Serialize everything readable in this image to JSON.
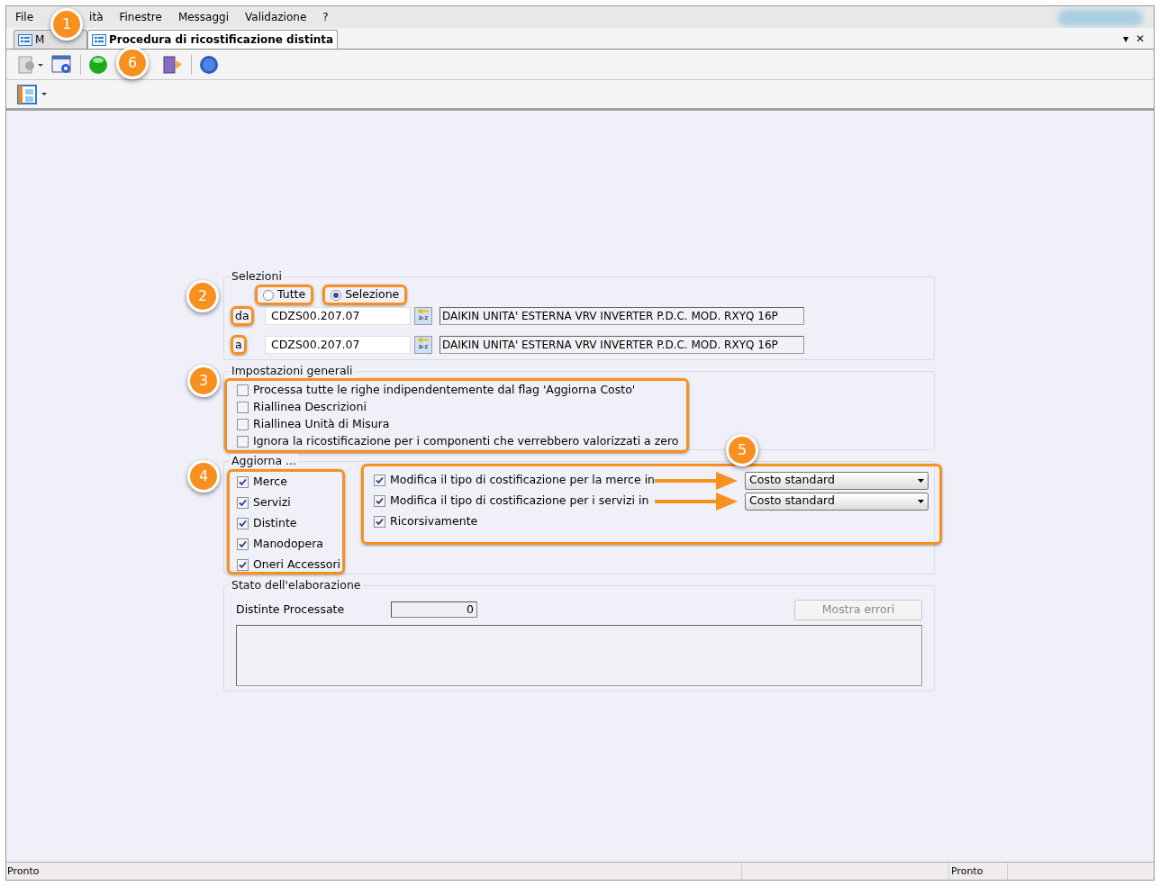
{
  "menu": [
    {
      "label": "File"
    },
    {
      "label": "ità"
    },
    {
      "label": "Finestre"
    },
    {
      "label": "Messaggi"
    },
    {
      "label": "Validazione"
    },
    {
      "label": "?"
    }
  ],
  "tabs": [
    {
      "label": "M",
      "selected": false
    },
    {
      "label": "Procedura di ricostificazione distinta",
      "selected": true
    }
  ],
  "tab_controls": {
    "dropdown": "▾",
    "close": "✕"
  },
  "selezioni": {
    "title": "Selezioni",
    "radios": [
      {
        "label": "Tutte",
        "selected": false
      },
      {
        "label": "Selezione",
        "selected": true
      }
    ],
    "ranges": [
      {
        "label": "da",
        "code": "CDZS00.207.07",
        "lookup": "a-z",
        "description": "DAIKIN UNITA' ESTERNA VRV INVERTER P.D.C. MOD. RXYQ 16P"
      },
      {
        "label": "a",
        "code": "CDZS00.207.07",
        "lookup": "a-z",
        "description": "DAIKIN UNITA' ESTERNA VRV INVERTER P.D.C. MOD. RXYQ 16P"
      }
    ]
  },
  "impostazioni": {
    "title": "Impostazioni generali",
    "options": [
      {
        "label": "Processa tutte le righe indipendentemente dal flag 'Aggiorna Costo'",
        "checked": false
      },
      {
        "label": "Riallinea Descrizioni",
        "checked": false
      },
      {
        "label": "Riallinea Unità di Misura",
        "checked": false
      },
      {
        "label": "Ignora la ricostificazione per i componenti che verrebbero valorizzati a zero",
        "checked": false
      }
    ]
  },
  "aggiorna": {
    "title": "Aggiorna ...",
    "items": [
      {
        "label": "Merce",
        "checked": true
      },
      {
        "label": "Servizi",
        "checked": true
      },
      {
        "label": "Distinte",
        "checked": true
      },
      {
        "label": "Manodopera",
        "checked": true
      },
      {
        "label": "Oneri Accessori",
        "checked": true
      }
    ],
    "modifiche": [
      {
        "label": "Modifica il tipo di costificazione per la merce in",
        "checked": true,
        "value": "Costo standard"
      },
      {
        "label": "Modifica il tipo di costificazione per i servizi in",
        "checked": true,
        "value": "Costo standard"
      },
      {
        "label": "Ricorsivamente",
        "checked": true
      }
    ]
  },
  "stato": {
    "title": "Stato dell'elaborazione",
    "counter_label": "Distinte Processate",
    "counter_value": "0",
    "button": {
      "label": "Mostra errori",
      "disabled": true
    }
  },
  "status_bar": [
    "Pronto",
    "Pronto"
  ],
  "callouts": [
    "1",
    "2",
    "3",
    "4",
    "5",
    "6"
  ]
}
